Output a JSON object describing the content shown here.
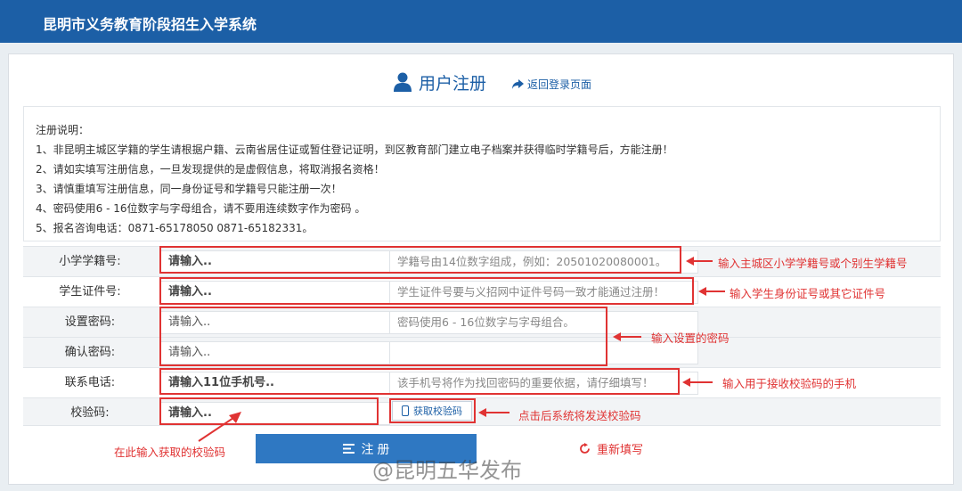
{
  "header": {
    "title": "昆明市义务教育阶段招生入学系统"
  },
  "page": {
    "title": "用户注册",
    "back_link": "返回登录页面"
  },
  "notice": {
    "lines": [
      "注册说明：",
      "1、非昆明主城区学籍的学生请根据户籍、云南省居住证或暂住登记证明，到区教育部门建立电子档案并获得临时学籍号后，方能注册！",
      "2、请如实填写注册信息，一旦发现提供的是虚假信息，将取消报名资格！",
      "3、请慎重填写注册信息，同一身份证号和学籍号只能注册一次！",
      "4、密码使用6 - 16位数字与字母组合，请不要用连续数字作为密码 。",
      "5、报名咨询电话：0871-65178050 0871-65182331。"
    ]
  },
  "form": {
    "student_id": {
      "label": "小学学籍号:",
      "placeholder": "请输入..",
      "hint": "学籍号由14位数字组成，例如：20501020080001。"
    },
    "cert_no": {
      "label": "学生证件号:",
      "placeholder": "请输入..",
      "hint": "学生证件号要与义招网中证件号码一致才能通过注册！"
    },
    "password": {
      "label": "设置密码:",
      "placeholder": "请输入..",
      "hint": "密码使用6 - 16位数字与字母组合。"
    },
    "confirm_password": {
      "label": "确认密码:",
      "placeholder": "请输入..",
      "hint": ""
    },
    "phone": {
      "label": "联系电话:",
      "placeholder": "请输入11位手机号..",
      "hint": "该手机号将作为找回密码的重要依据，请仔细填写！"
    },
    "verify_code": {
      "label": "校验码:",
      "placeholder": "请输入..",
      "button": "获取校验码"
    }
  },
  "actions": {
    "submit": "注 册",
    "reset": "重新填写"
  },
  "annotations": {
    "student_id": "输入主城区小学学籍号或个别生学籍号",
    "cert_no": "输入学生身份证号或其它证件号",
    "password": "输入设置的密码",
    "phone": "输入用于接收校验码的手机",
    "code_button": "点击后系统将发送校验码",
    "code_input": "在此输入获取的校验码"
  },
  "watermark": "@昆明五华发布",
  "colors": {
    "header": "#1c5fa6",
    "accent": "#2f78c2",
    "annotation": "#e03333"
  }
}
